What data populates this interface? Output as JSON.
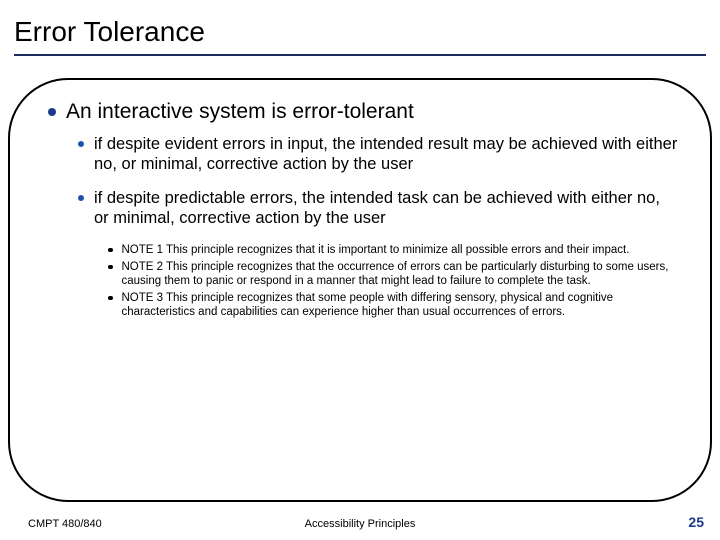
{
  "title": "Error Tolerance",
  "main_bullet": "An interactive system is error-tolerant",
  "sub_bullets": [
    "if despite evident errors in input, the intended result may be achieved with either no, or minimal, corrective action by the user",
    "if despite predictable errors, the intended task can be achieved with either no, or minimal, corrective action by the user"
  ],
  "notes": [
    "NOTE 1 This principle recognizes that it is important to minimize all possible errors and their impact.",
    "NOTE 2 This principle recognizes that the occurrence of errors can be particularly disturbing to some users, causing them to panic or respond in a manner that might lead to failure to complete the task.",
    "NOTE 3 This principle recognizes that some people with differing sensory, physical and cognitive characteristics and capabilities can experience higher than usual occurrences of errors."
  ],
  "footer": {
    "left": "CMPT 480/840",
    "center": "Accessibility Principles",
    "page": "25"
  }
}
